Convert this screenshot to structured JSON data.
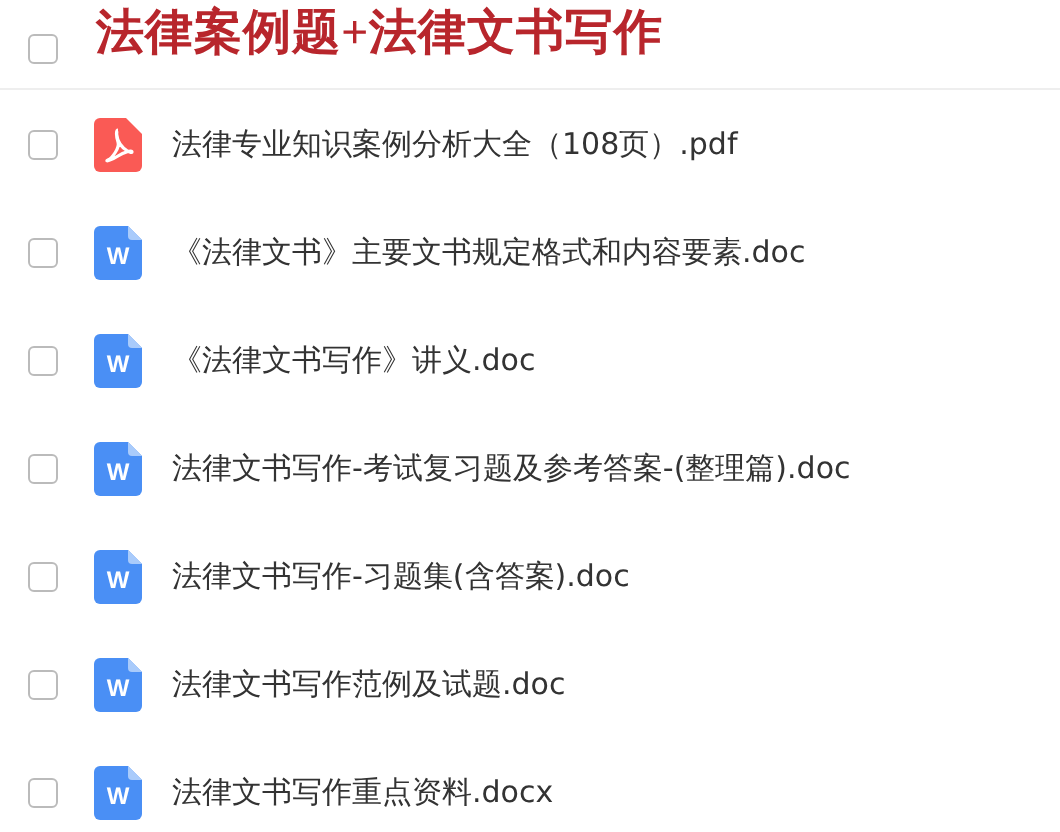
{
  "title": "法律案例题+法律文书写作",
  "partial_row": {
    "checked": false
  },
  "files": [
    {
      "name": "法律专业知识案例分析大全（108页）.pdf",
      "kind": "pdf",
      "checked": false
    },
    {
      "name": "《法律文书》主要文书规定格式和内容要素.doc",
      "kind": "word",
      "icon_text": "W",
      "checked": false
    },
    {
      "name": "《法律文书写作》讲义.doc",
      "kind": "word",
      "icon_text": "W",
      "checked": false
    },
    {
      "name": "法律文书写作-考试复习题及参考答案-(整理篇).doc",
      "kind": "word",
      "icon_text": "W",
      "checked": false
    },
    {
      "name": "法律文书写作-习题集(含答案).doc",
      "kind": "word",
      "icon_text": "W",
      "checked": false
    },
    {
      "name": "法律文书写作范例及试题.doc",
      "kind": "word",
      "icon_text": "W",
      "checked": false
    },
    {
      "name": "法律文书写作重点资料.docx",
      "kind": "word",
      "icon_text": "W",
      "checked": false
    }
  ]
}
